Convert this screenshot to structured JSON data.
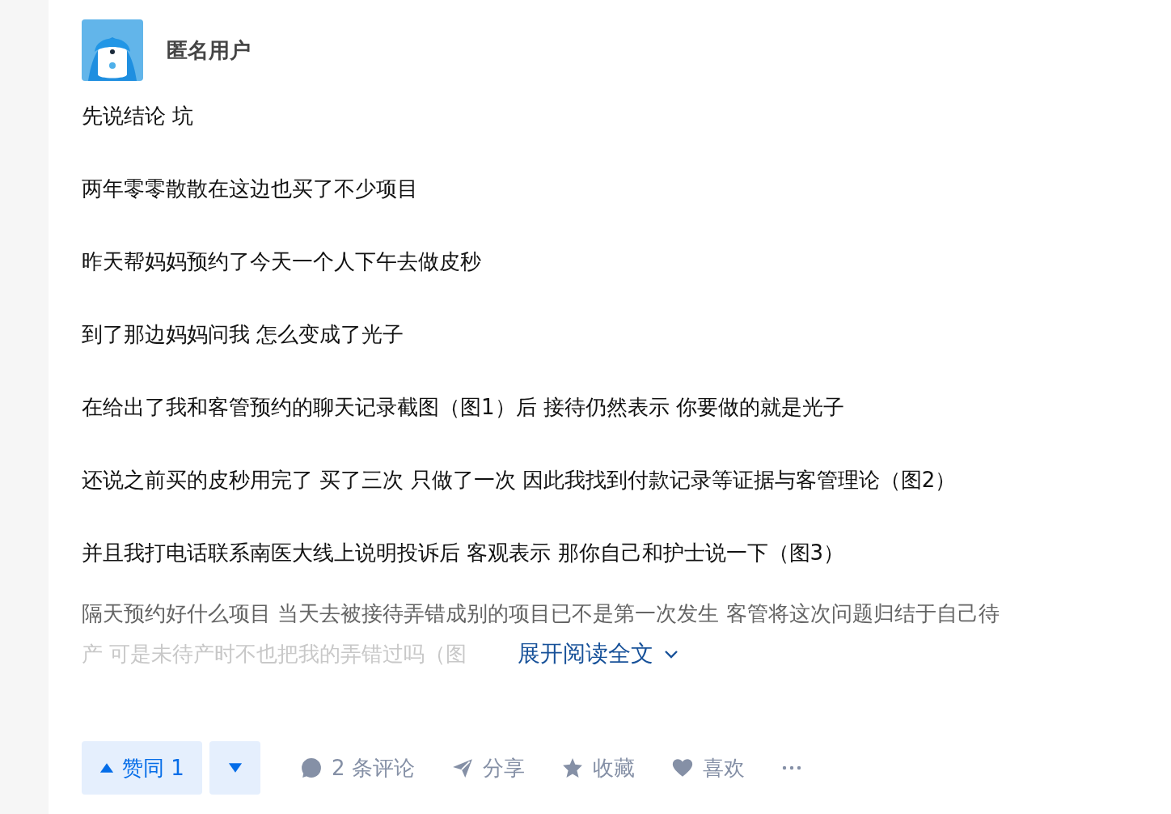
{
  "author": {
    "name": "匿名用户"
  },
  "paragraphs": [
    "先说结论 坑",
    "两年零零散散在这边也买了不少项目",
    "昨天帮妈妈预约了今天一个人下午去做皮秒",
    "到了那边妈妈问我 怎么变成了光子",
    "在给出了我和客管预约的聊天记录截图（图1）后 接待仍然表示 你要做的就是光子",
    "还说之前买的皮秒用完了 买了三次 只做了一次 因此我找到付款记录等证据与客管理论（图2）",
    "并且我打电话联系南医大线上说明投诉后 客观表示 那你自己和护士说一下（图3）"
  ],
  "faded_lines": [
    "隔天预约好什么项目 当天去被接待弄错成别的项目已不是第一次发生 客管将这次问题归结于自己待",
    "产 可是未待产时不也把我的弄错过吗（图"
  ],
  "expand": {
    "label": "展开阅读全文"
  },
  "actions": {
    "upvote": {
      "label": "赞同 1"
    },
    "buttons": [
      {
        "kind": "comment",
        "label": "2 条评论"
      },
      {
        "kind": "share",
        "label": "分享"
      },
      {
        "kind": "collect",
        "label": "收藏"
      },
      {
        "kind": "like",
        "label": "喜欢"
      },
      {
        "kind": "more"
      }
    ]
  }
}
